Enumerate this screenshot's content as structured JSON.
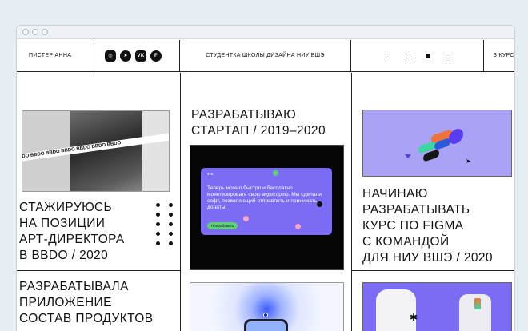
{
  "topbar": {
    "name": "ПИСТЕР АННА",
    "social": [
      {
        "icon": "instagram-icon",
        "glyph": "◎"
      },
      {
        "icon": "telegram-icon",
        "glyph": "➤"
      },
      {
        "icon": "vk-icon",
        "glyph": "vk"
      },
      {
        "icon": "facebook-icon",
        "glyph": "f"
      }
    ],
    "tagline": "СТУДЕНТКА ШКОЛЫ ДИЗАЙНА НИУ ВШЭ",
    "course": "3 КУРС"
  },
  "cards": {
    "bbdo": {
      "title": "СТАЖИРУЮСЬ\nНА ПОЗИЦИИ\nАРТ-ДИРЕКТОРА\nВ BBDO / 2020",
      "tape_text": "BBDO BBDO BBDO BBDO BBDO BBDO BBDO"
    },
    "startup": {
      "title": "РАЗРАБАТЫВАЮ\nСТАРТАП / 2019–2020",
      "screen_text": "Теперь можно быстро и бесплатно монетизировать свою аудиторию. Мы сделали софт, позволяющий отправлять и принимать донаты.",
      "screen_button": "Попробовать"
    },
    "figma": {
      "title": "НАЧИНАЮ\nРАЗРАБАТЫВАТЬ\nКУРС ПО FIGMA\nС КОМАНДОЙ\nДЛЯ НИУ ВШЭ / 2020"
    },
    "app": {
      "title": "РАЗРАБАТЫВАЛА\nПРИЛОЖЕНИЕ\nСОСТАВ ПРОДУКТОВ"
    }
  },
  "colors": {
    "purple": "#7c6cf2",
    "lavender": "#a9a2f5",
    "accent_green": "#5fd07a",
    "orange": "#f1733b",
    "blue": "#2b5bd8"
  }
}
